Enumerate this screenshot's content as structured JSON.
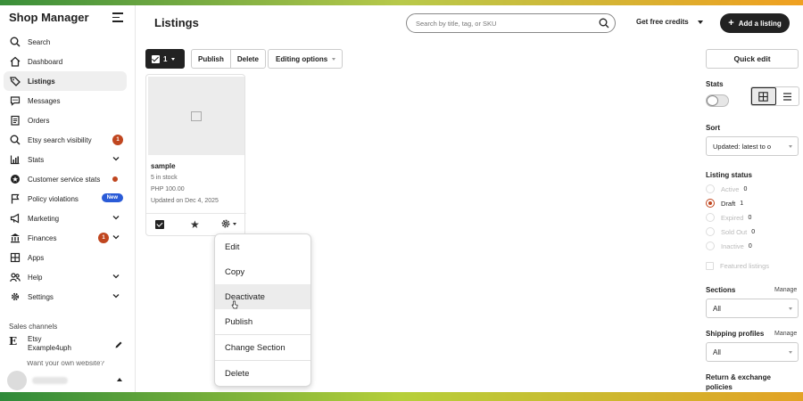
{
  "brand": "Shop Manager",
  "nav": [
    {
      "label": "Search"
    },
    {
      "label": "Dashboard"
    },
    {
      "label": "Listings"
    },
    {
      "label": "Messages"
    },
    {
      "label": "Orders"
    },
    {
      "label": "Etsy search visibility",
      "badge": "1"
    },
    {
      "label": "Stats"
    },
    {
      "label": "Customer service stats"
    },
    {
      "label": "Policy violations",
      "badge": "New"
    },
    {
      "label": "Marketing"
    },
    {
      "label": "Finances",
      "badge": "1"
    },
    {
      "label": "Apps"
    },
    {
      "label": "Help"
    },
    {
      "label": "Settings"
    }
  ],
  "sales_channels": {
    "label": "Sales channels",
    "etsy": {
      "logo": "E",
      "name": "Etsy",
      "shop": "Example4uph"
    },
    "cut_text": "Want your own website?"
  },
  "header": {
    "title": "Listings",
    "search_placeholder": "Search by title, tag, or SKU",
    "credits": "Get free credits",
    "add_listing": "Add a listing"
  },
  "toolbar": {
    "selected_count": "1",
    "publish": "Publish",
    "delete": "Delete",
    "editing_options": "Editing options"
  },
  "card": {
    "title": "sample",
    "stock": "5 in stock",
    "price": "PHP 100.00",
    "updated": "Updated on Dec 4, 2025"
  },
  "dropdown": [
    "Edit",
    "Copy",
    "Deactivate",
    "Publish",
    "Change Section",
    "Delete"
  ],
  "right": {
    "quick_edit": "Quick edit",
    "stats": "Stats",
    "sort_label": "Sort",
    "sort_value": "Updated: latest to o",
    "listing_status": "Listing status",
    "statuses": [
      {
        "label": "Active",
        "count": "0"
      },
      {
        "label": "Draft",
        "count": "1"
      },
      {
        "label": "Expired",
        "count": "0"
      },
      {
        "label": "Sold Out",
        "count": "0"
      },
      {
        "label": "Inactive",
        "count": "0"
      }
    ],
    "featured": "Featured listings",
    "sections": "Sections",
    "manage": "Manage",
    "sections_value": "All",
    "shipping": "Shipping profiles",
    "shipping_value": "All",
    "return_policies": "Return & exchange policies"
  },
  "colors": {
    "accent": "#c0461f",
    "new_badge": "#2a5bd7",
    "dark": "#222222"
  }
}
